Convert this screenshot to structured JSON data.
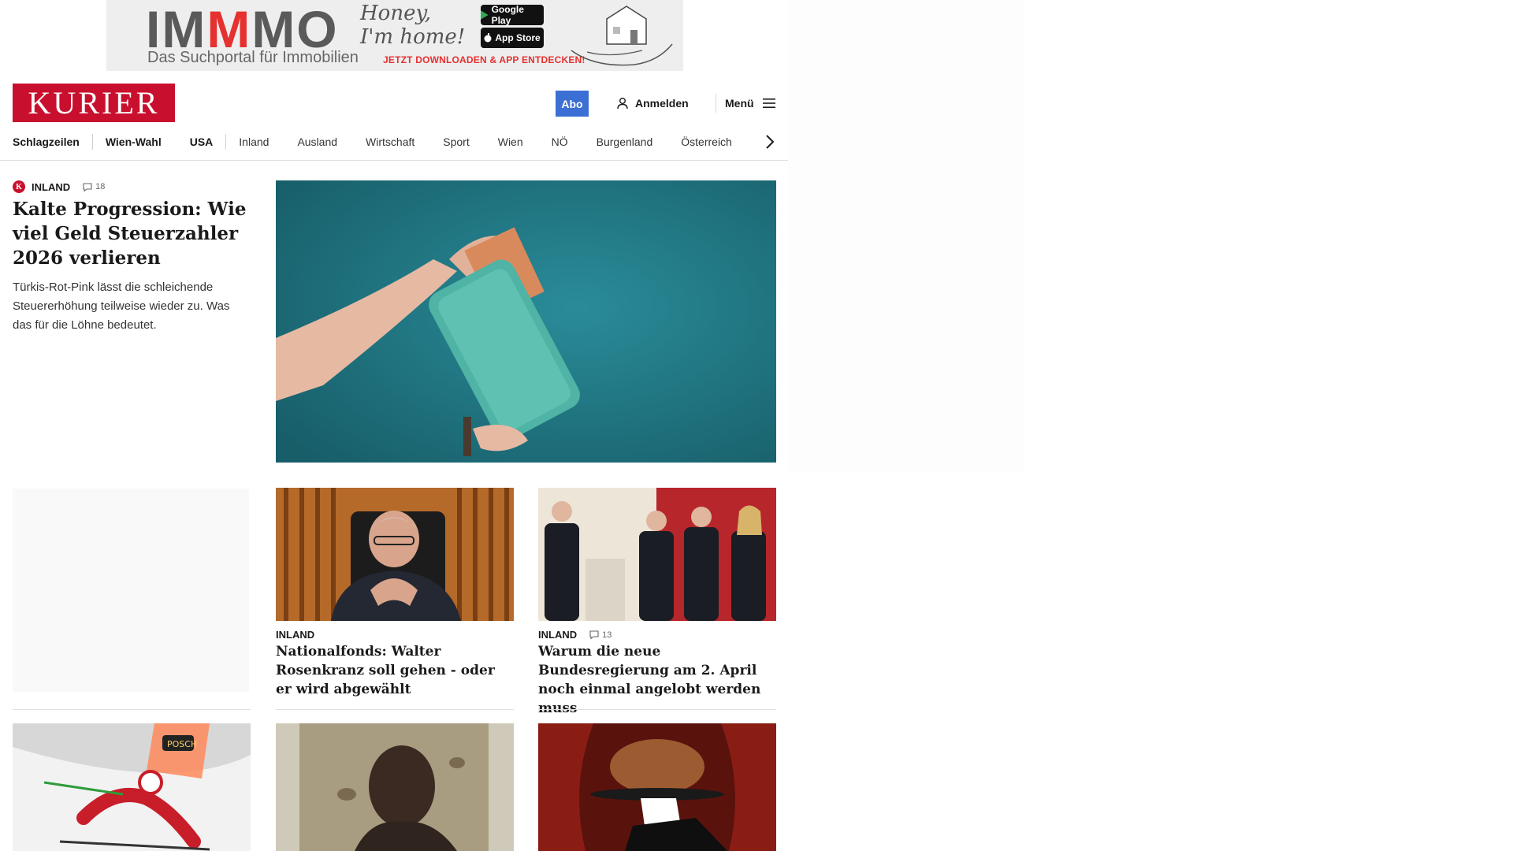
{
  "ad": {
    "logo_left": "IM",
    "logo_mid": "M",
    "logo_right": "MO",
    "subtitle": "Das Suchportal für Immobilien",
    "script_text": "Honey, I'm home!",
    "google_play": "Google Play",
    "app_store": "App Store",
    "cta": "JETZT DOWNLOADEN & APP ENTDECKEN!"
  },
  "header": {
    "logo": "KURIER",
    "abo_label": "Abo",
    "login_label": "Anmelden",
    "menu_label": "Menü"
  },
  "nav": {
    "items": [
      "Schlagzeilen",
      "Wien-Wahl",
      "USA",
      "Inland",
      "Ausland",
      "Wirtschaft",
      "Sport",
      "Wien",
      "NÖ",
      "Burgenland",
      "Österreich"
    ]
  },
  "lead": {
    "category": "INLAND",
    "comments": "18",
    "title": "Kalte Progression: Wie viel Geld Steuerzahler 2026 verlieren",
    "teaser": "Türkis-Rot-Pink lässt die schleichende Steuererhöhung teilweise wieder zu. Was das für die Löhne bedeutet."
  },
  "cards": [
    {
      "category": "INLAND",
      "comments": "",
      "title": "Nationalfonds: Walter Rosenkranz soll gehen - oder er wird abgewählt"
    },
    {
      "category": "INLAND",
      "comments": "13",
      "title": "Warum die neue Bundesregierung am 2. April noch einmal angelobt werden muss"
    }
  ],
  "colors": {
    "brand": "#c8102e",
    "abo": "#3b6fd4",
    "lead_bg": "#1f7f8c"
  }
}
